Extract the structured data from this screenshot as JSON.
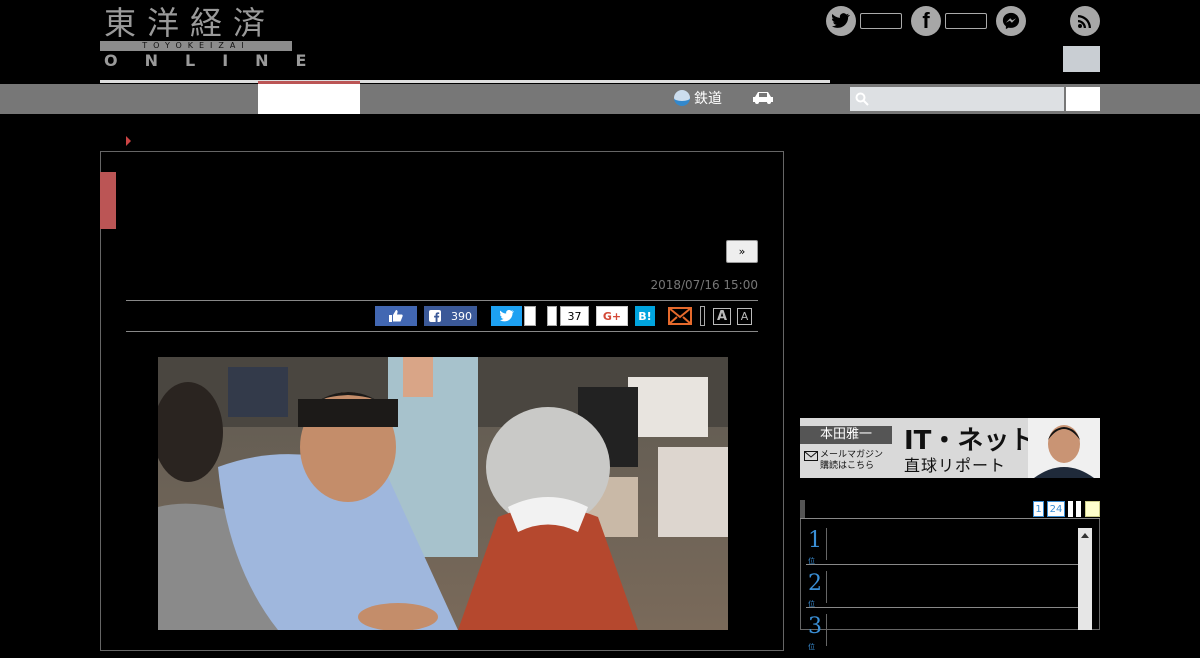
{
  "header": {
    "logo_jp": "東洋経済",
    "logo_roman": "TOYOKEIZAI",
    "logo_online": "ONLINE"
  },
  "social": {
    "twitter_icon": "twitter-icon",
    "facebook_icon": "facebook-icon",
    "messenger_icon": "messenger-icon",
    "rss_icon": "rss-icon"
  },
  "nav": {
    "rail_label": "鉄道"
  },
  "article": {
    "next_label": "»",
    "date": "2018/07/16 15:00",
    "share": {
      "facebook_count": "390",
      "pocket_count": "37",
      "google_label": "G+",
      "hatena_label": "B!",
      "font_large": "A",
      "font_small": "A"
    }
  },
  "sidebar": {
    "banner": {
      "name": "本田雅一",
      "sub_line1": "メールマガジン",
      "sub_line2": "購読はこちら",
      "title_line1": "IT・ネット",
      "title_line2": "直球リポート"
    },
    "ranking": {
      "tabs": [
        "1",
        "24"
      ],
      "items": [
        {
          "num": "1",
          "unit": "位"
        },
        {
          "num": "2",
          "unit": "位"
        },
        {
          "num": "3",
          "unit": "位"
        }
      ]
    }
  }
}
